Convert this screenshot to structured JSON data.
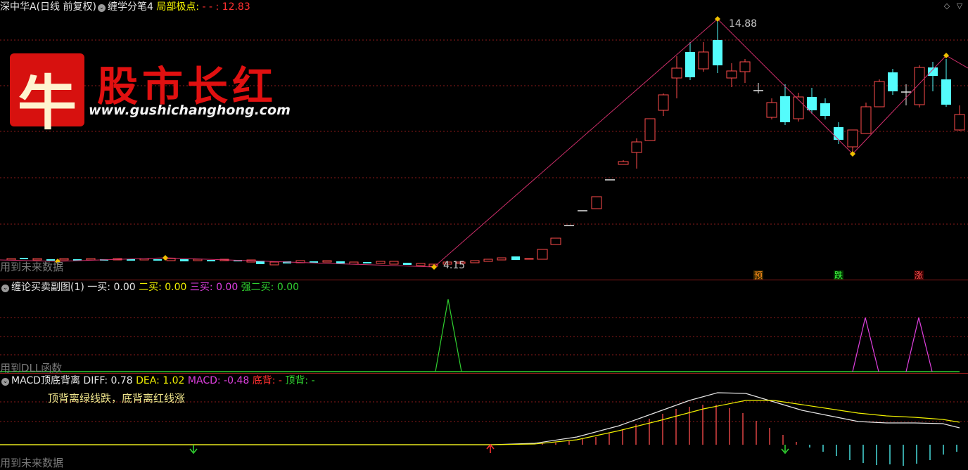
{
  "main": {
    "security_label": "深中华A(日线 前复权)",
    "indicator_name": "缠学分笔4",
    "extreme_label": "局部极点:",
    "extreme_value": "- - : 12.83",
    "peak_label": "14.88",
    "trough_label": "4.15",
    "watermark": "用到未来数据",
    "markers": [
      "预",
      "跌",
      "涨"
    ]
  },
  "logo": {
    "char": "牛",
    "title": "股市长红",
    "url": "www.gushichanghong.com"
  },
  "panel2": {
    "title": "缠论买卖副图(1)",
    "items": [
      {
        "label": "一买:",
        "value": "0.00",
        "color": "#e6e6e6"
      },
      {
        "label": "二买:",
        "value": "0.00",
        "color": "#f0f000"
      },
      {
        "label": "三买:",
        "value": "0.00",
        "color": "#e040e0"
      },
      {
        "label": "强二买:",
        "value": "0.00",
        "color": "#30d030"
      }
    ],
    "watermark": "用到DLL函数"
  },
  "panel3": {
    "title": "MACD顶底背离",
    "items": [
      {
        "label": "DIFF:",
        "value": "0.78",
        "color": "#e6e6e6"
      },
      {
        "label": "DEA:",
        "value": "1.02",
        "color": "#f0f000"
      },
      {
        "label": "MACD:",
        "value": "-0.48",
        "color": "#e040e0"
      },
      {
        "label": "底背:",
        "value": "-",
        "color": "#ff3030"
      },
      {
        "label": "顶背:",
        "value": "-",
        "color": "#30d030"
      }
    ],
    "note": "顶背离绿线跌，底背离红线涨",
    "watermark": "用到未来数据"
  },
  "colors": {
    "up": "#ff4d4d",
    "down": "#54fcfc",
    "pen_line": "#d22f6c",
    "grid": "#8b1a1a"
  }
}
